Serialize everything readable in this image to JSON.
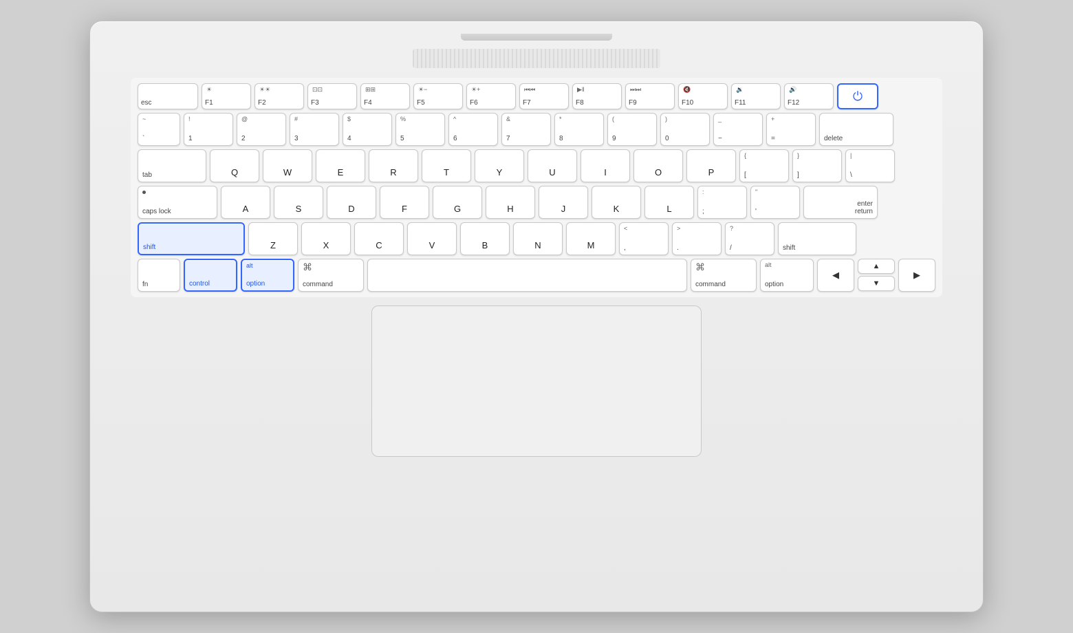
{
  "keyboard": {
    "fn_row": [
      {
        "id": "esc",
        "label": "esc",
        "width": "esc"
      },
      {
        "id": "f1",
        "top": "☀",
        "bottom": "F1",
        "icon": true
      },
      {
        "id": "f2",
        "top": "☀",
        "bottom": "F2",
        "icon": true
      },
      {
        "id": "f3",
        "top": "⊞",
        "bottom": "F3",
        "icon": true
      },
      {
        "id": "f4",
        "top": "⊟",
        "bottom": "F4",
        "icon": true
      },
      {
        "id": "f5",
        "top": "☀",
        "bottom": "F5",
        "icon": true
      },
      {
        "id": "f6",
        "top": "☀",
        "bottom": "F6",
        "icon": true
      },
      {
        "id": "f7",
        "top": "⏮",
        "bottom": "F7",
        "icon": true
      },
      {
        "id": "f8",
        "top": "⏯",
        "bottom": "F8",
        "icon": true
      },
      {
        "id": "f9",
        "top": "⏭",
        "bottom": "F9",
        "icon": true
      },
      {
        "id": "f10",
        "top": "🔇",
        "bottom": "F10",
        "icon": true
      },
      {
        "id": "f11",
        "top": "🔉",
        "bottom": "F11",
        "icon": true
      },
      {
        "id": "f12",
        "top": "🔊",
        "bottom": "F12",
        "icon": true
      },
      {
        "id": "power",
        "label": "⏻",
        "highlighted": true
      }
    ],
    "num_row": [
      {
        "top": "~",
        "bottom": "`"
      },
      {
        "top": "!",
        "bottom": "1"
      },
      {
        "top": "@",
        "bottom": "2"
      },
      {
        "top": "#",
        "bottom": "3"
      },
      {
        "top": "$",
        "bottom": "4"
      },
      {
        "top": "%",
        "bottom": "5"
      },
      {
        "top": "^",
        "bottom": "6"
      },
      {
        "top": "&",
        "bottom": "7"
      },
      {
        "top": "*",
        "bottom": "8"
      },
      {
        "top": "(",
        "bottom": "9"
      },
      {
        "top": ")",
        "bottom": "0"
      },
      {
        "top": "_",
        "bottom": "−"
      },
      {
        "top": "+",
        "bottom": "="
      },
      {
        "label": "delete"
      }
    ],
    "qwerty_row": [
      "Q",
      "W",
      "E",
      "R",
      "T",
      "Y",
      "U",
      "I",
      "O",
      "P"
    ],
    "brackets": [
      {
        "top": "{",
        "bottom": "["
      },
      {
        "top": "}",
        "bottom": "]"
      },
      {
        "top": "|",
        "bottom": "\\"
      }
    ],
    "asdf_row": [
      "A",
      "S",
      "D",
      "F",
      "G",
      "H",
      "J",
      "K",
      "L"
    ],
    "semicolon": {
      "top": ":",
      "bottom": ";"
    },
    "quote": {
      "top": "\"",
      "bottom": "'"
    },
    "zxcv_row": [
      "Z",
      "X",
      "C",
      "V",
      "B",
      "N",
      "M"
    ],
    "ltgt": [
      {
        "top": "<",
        "bottom": ","
      },
      {
        "top": ">",
        "bottom": "."
      },
      {
        "top": "?",
        "bottom": "/"
      }
    ],
    "bottom_row": {
      "fn": "fn",
      "control": "control",
      "option_left_alt": "alt",
      "option_left": "option",
      "command_left_sym": "⌘",
      "command_left": "command",
      "command_right_sym": "⌘",
      "command_right": "command",
      "option_right_alt": "alt",
      "option_right": "option",
      "arrow_left": "◀",
      "arrow_up": "▲",
      "arrow_down": "▼",
      "arrow_right": "▶"
    }
  },
  "highlighted_keys": [
    "shift_left",
    "control",
    "option_left"
  ],
  "colors": {
    "highlight": "#3366ff",
    "highlight_bg": "#e8f0ff",
    "key_bg": "#ffffff",
    "key_border": "#c8c8c8"
  }
}
